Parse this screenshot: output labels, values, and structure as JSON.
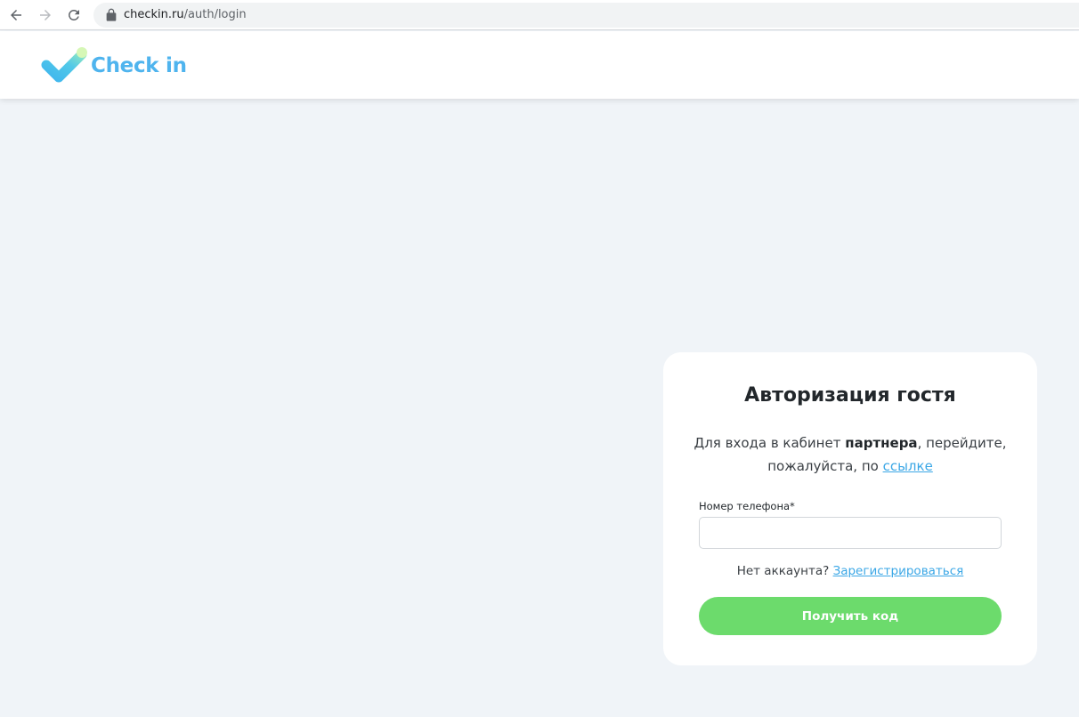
{
  "browser": {
    "url_host": "checkin.ru",
    "url_path": "/auth/login"
  },
  "header": {
    "logo_text": "Check in"
  },
  "login_card": {
    "title": "Авторизация гостя",
    "desc_before": "Для входа в кабинет ",
    "desc_bold": "партнера",
    "desc_middle": ", перейдите, пожалуйста, по ",
    "desc_link": "ссылке",
    "phone_label": "Номер телефона*",
    "phone_value": "",
    "no_account_text": "Нет аккаунта? ",
    "register_link": "Зарегистрироваться",
    "submit_label": "Получить код"
  },
  "colors": {
    "accent_blue": "#3ba7e6",
    "button_green": "#6cdb6c",
    "page_background": "#f0f4f8"
  }
}
